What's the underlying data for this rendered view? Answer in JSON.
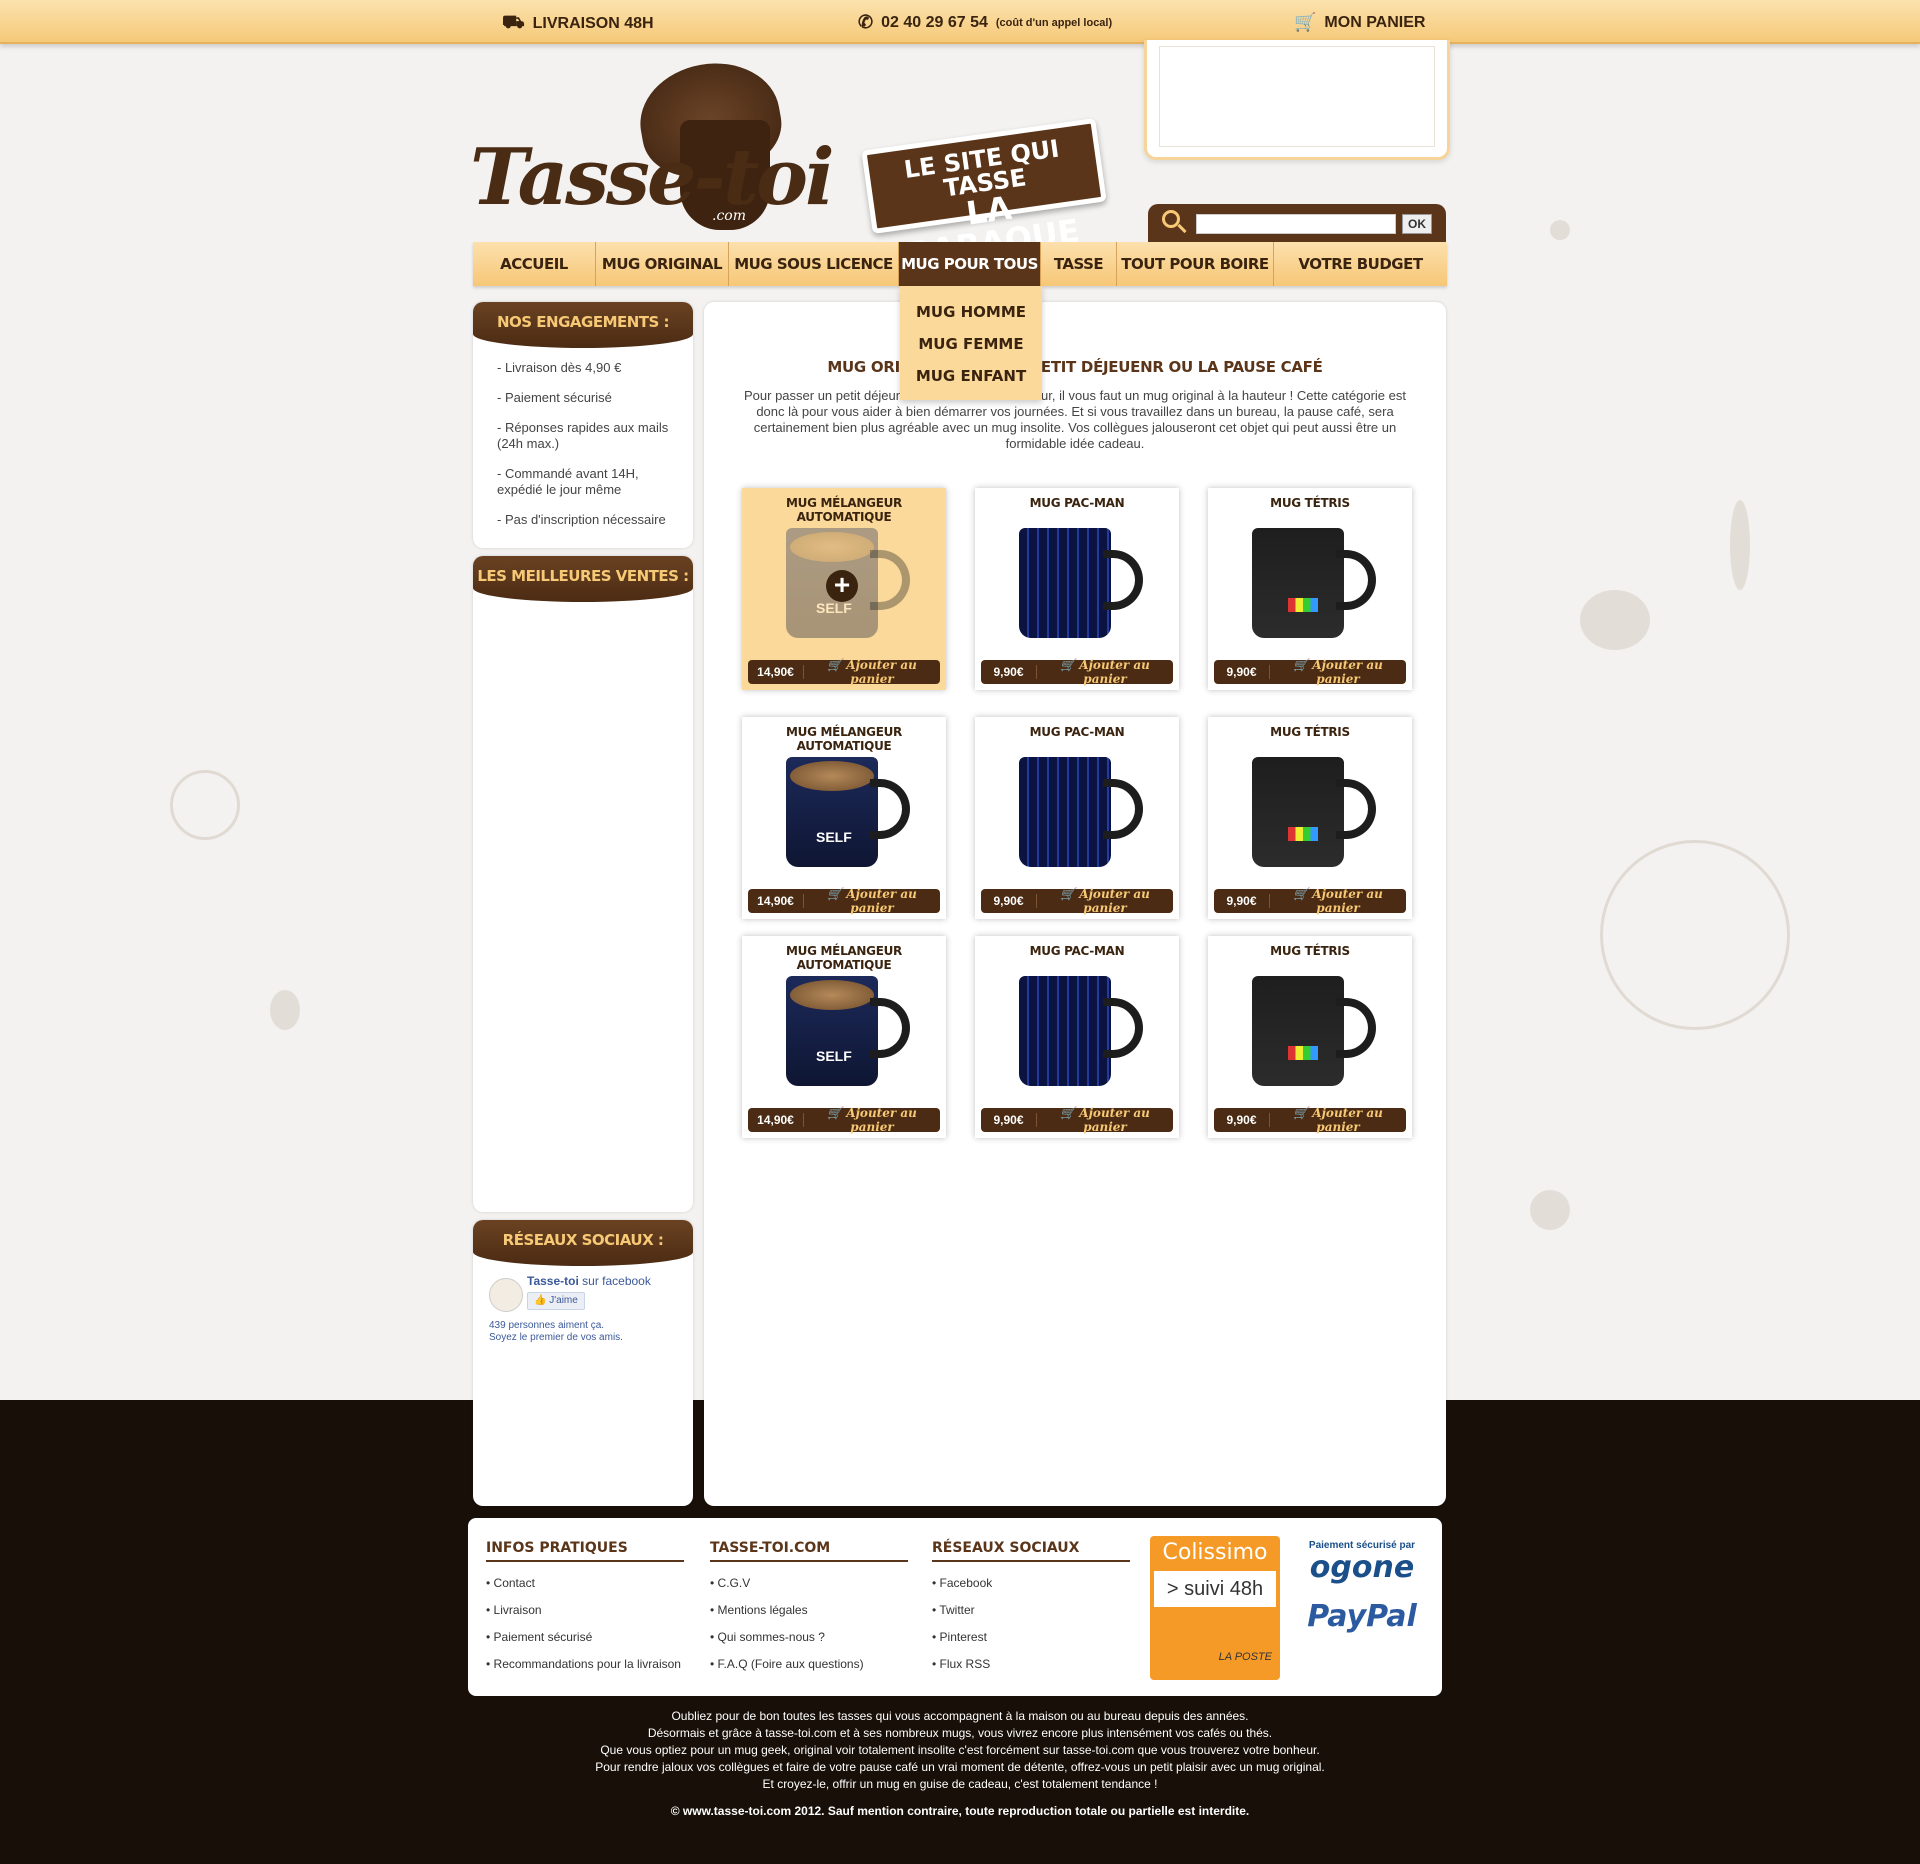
{
  "topbar": {
    "delivery": "LIVRAISON 48H",
    "phone": "02 40 29 67 54",
    "phone_note": "(coût d'un appel local)",
    "cart": "MON PANIER"
  },
  "logo": {
    "name": "Tasse-toi",
    "suffix": ".com"
  },
  "slogan": {
    "line1": "LE SITE QUI TASSE",
    "line2": "LA BARAQUE"
  },
  "search": {
    "placeholder": "",
    "button": "OK"
  },
  "nav": {
    "items": [
      "ACCUEIL",
      "MUG ORIGINAL",
      "MUG SOUS LICENCE",
      "MUG POUR TOUS",
      "TASSE",
      "TOUT POUR BOIRE",
      "VOTRE BUDGET"
    ],
    "active": "MUG POUR TOUS",
    "dropdown": [
      "MUG HOMME",
      "MUG FEMME",
      "MUG ENFANT"
    ]
  },
  "sidebar": {
    "engagements_title": "NOS ENGAGEMENTS :",
    "engagements": [
      "- Livraison dès 4,90 €",
      "- Paiement sécurisé",
      "- Réponses rapides aux mails (24h max.)",
      "- Commandé avant 14H, expédié le jour même",
      "- Pas d'inscription nécessaire"
    ],
    "best_title": "LES MEILLEURES VENTES :",
    "social_title": "RÉSEAUX SOCIAUX :",
    "fb_page": "Tasse-toi",
    "fb_suffix": "sur facebook",
    "fb_like": "J'aime",
    "fb_count": "439 personnes aiment ça.",
    "fb_first": "Soyez le premier de vos amis."
  },
  "main": {
    "title": "MUG ORIGINAL POUR LE PETIT DÉJEUENR OU LA PAUSE CAFÉ",
    "title_left": "MUG ORIGINA",
    "title_right": "R LE PETIT DÉJEUENR OU LA PAUSE CAFÉ",
    "intro": "Pour passer un petit déjeuner en toute bonne humeur, il vous faut un mug original à la hauteur ! Cette catégorie est donc là pour vous aider à bien démarrer vos journées. Et si vous travaillez dans un bureau, la pause café, sera certainement bien plus agréable avec un mug insolite. Vos collègues jalouseront cet objet qui peut aussi être un formidable idée cadeau.",
    "add_label": "Ajouter au panier",
    "products": [
      {
        "name": "MUG MÉLANGEUR AUTOMATIQUE",
        "price": "14,90€",
        "kind": "self"
      },
      {
        "name": "MUG PAC-MAN",
        "price": "9,90€",
        "kind": "pac"
      },
      {
        "name": "MUG TÉTRIS",
        "price": "9,90€",
        "kind": "tet"
      },
      {
        "name": "MUG MÉLANGEUR AUTOMATIQUE",
        "price": "14,90€",
        "kind": "self"
      },
      {
        "name": "MUG PAC-MAN",
        "price": "9,90€",
        "kind": "pac"
      },
      {
        "name": "MUG TÉTRIS",
        "price": "9,90€",
        "kind": "tet"
      },
      {
        "name": "MUG MÉLANGEUR AUTOMATIQUE",
        "price": "14,90€",
        "kind": "self"
      },
      {
        "name": "MUG PAC-MAN",
        "price": "9,90€",
        "kind": "pac"
      },
      {
        "name": "MUG TÉTRIS",
        "price": "9,90€",
        "kind": "tet"
      }
    ]
  },
  "footer": {
    "cols": [
      {
        "title": "INFOS PRATIQUES",
        "items": [
          "Contact",
          "Livraison",
          "Paiement sécurisé",
          "Recommandations pour la livraison"
        ]
      },
      {
        "title": "TASSE-TOI.COM",
        "items": [
          "C.G.V",
          "Mentions légales",
          "Qui sommes-nous ?",
          "F.A.Q (Foire aux questions)"
        ]
      },
      {
        "title": "RÉSEAUX SOCIAUX",
        "items": [
          "Facebook",
          "Twitter",
          "Pinterest",
          "Flux RSS"
        ]
      }
    ],
    "colissimo": "Colissimo",
    "suivi": "> suivi 48h",
    "laposte": "LA POSTE",
    "paiement": "Paiement sécurisé par",
    "ogone": "ogone",
    "paypal": "PayPal"
  },
  "seo": [
    "Oubliez pour de bon toutes les tasses qui vous accompagnent à la maison ou au bureau depuis des années.",
    "Désormais et grâce à tasse-toi.com et à ses nombreux mugs, vous vivrez encore plus intensément vos cafés ou thés.",
    "Que vous optiez pour un mug geek, original voir totalement insolite c'est forcément sur tasse-toi.com que vous trouverez votre bonheur.",
    "Pour rendre jaloux vos collègues et faire de votre pause café un vrai moment de détente, offrez-vous un petit plaisir avec un mug original.",
    "Et croyez-le, offrir un mug en guise de cadeau, c'est totalement tendance !"
  ],
  "copyright": "© www.tasse-toi.com 2012. Sauf mention contraire, toute reproduction totale ou partielle est interdite."
}
